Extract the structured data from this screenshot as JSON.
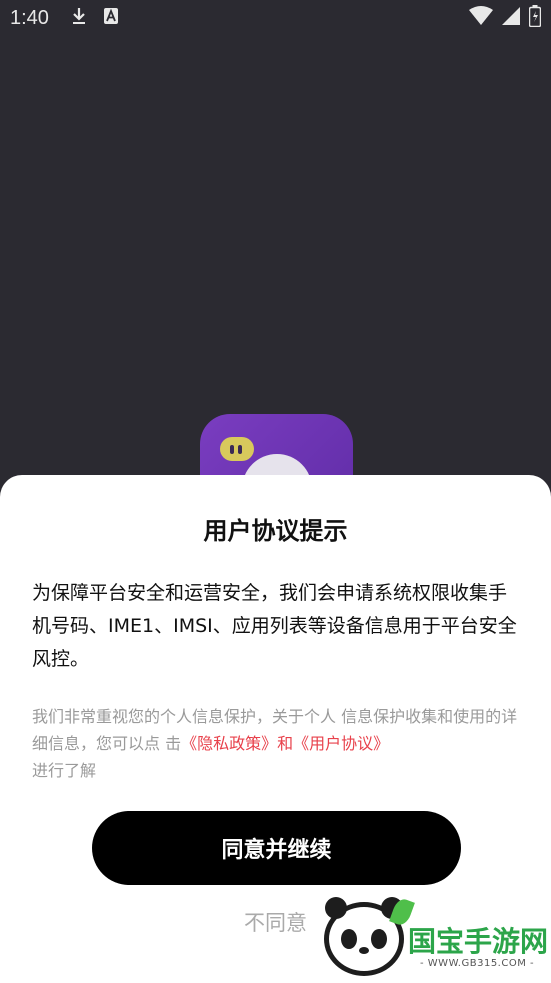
{
  "status_bar": {
    "time": "1:40",
    "left_icons": [
      "download-icon",
      "notification-a-icon"
    ],
    "right_icons": [
      "wifi-icon",
      "signal-icon",
      "battery-icon"
    ]
  },
  "dialog": {
    "title": "用户协议提示",
    "body": "为保障平台安全和运营安全，我们会申请系统权限收集手机号码、IME1、IMSI、应用列表等设备信息用于平台安全风控。",
    "note_prefix": "我们非常重视您的个人信息保护，关于个人 信息保护收集和使用的详细信息，您可以点 击",
    "privacy_link": "《隐私政策》",
    "note_and": "和",
    "agreement_link": "《用户协议》",
    "note_suffix": "进行了解",
    "agree_label": "同意并继续",
    "disagree_label": "不同意"
  },
  "watermark": {
    "brand": "国宝手游网",
    "url": "- WWW.GB315.COM -"
  },
  "colors": {
    "background": "#2b2a31",
    "link": "#e8414b",
    "primary_button": "#000000"
  }
}
